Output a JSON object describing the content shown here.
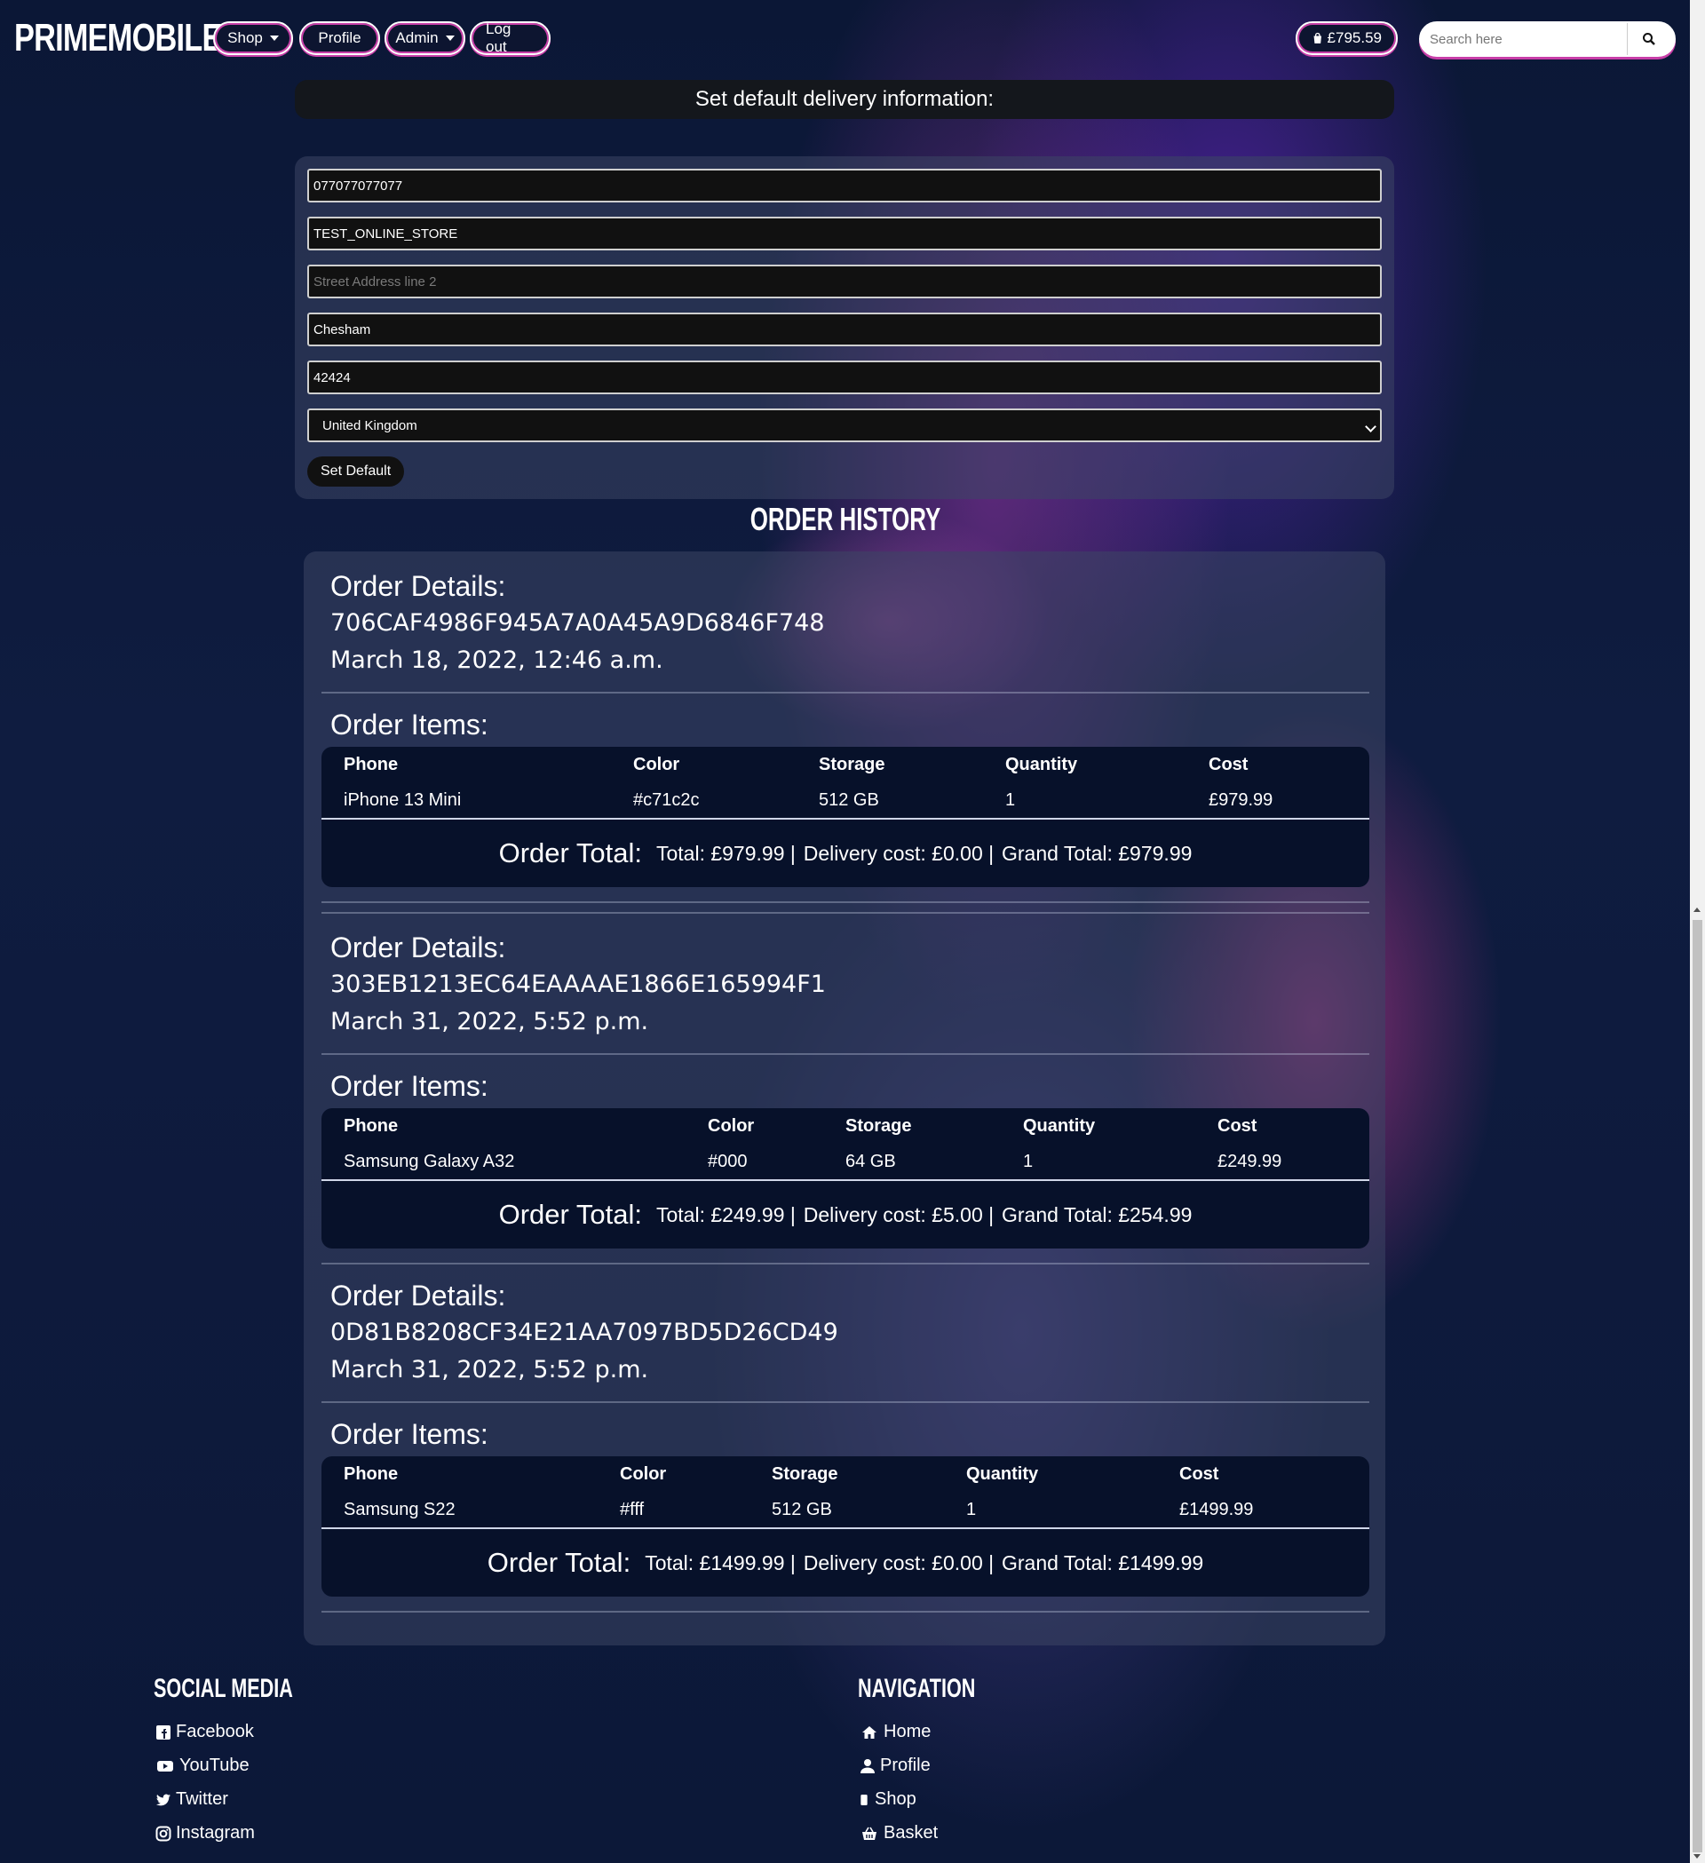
{
  "nav": {
    "brand": "PRIMEMOBILE",
    "shop": "Shop",
    "profile": "Profile",
    "admin": "Admin",
    "logout": "Log out",
    "basket_total": "£795.59",
    "search_placeholder": "Search here"
  },
  "delivery": {
    "title": "Set default delivery information:",
    "phone": "077077077077",
    "address1": "TEST_ONLINE_STORE",
    "address2_placeholder": "Street Address line 2",
    "city": "Chesham",
    "postcode": "42424",
    "country": "United Kingdom",
    "button": "Set Default"
  },
  "history": {
    "title": "ORDER HISTORY",
    "details_label": "Order Details:",
    "items_label": "Order Items:",
    "total_label": "Order Total:",
    "columns": [
      "Phone",
      "Color",
      "Storage",
      "Quantity",
      "Cost"
    ],
    "orders": [
      {
        "id": "706CAF4986F945A7A0A45A9D6846F748",
        "date": "March 18, 2022, 12:46 a.m.",
        "item": {
          "phone": "iPhone 13 Mini",
          "color": "#c71c2c",
          "storage": "512 GB",
          "quantity": "1",
          "cost": "£979.99"
        },
        "total": "Total: £979.99 |",
        "delivery": "Delivery cost: £0.00 |",
        "grand": "Grand Total: £979.99"
      },
      {
        "id": "303EB1213EC64EAAAAE1866E165994F1",
        "date": "March 31, 2022, 5:52 p.m.",
        "item": {
          "phone": "Samsung Galaxy A32",
          "color": "#000",
          "storage": "64 GB",
          "quantity": "1",
          "cost": "£249.99"
        },
        "total": "Total: £249.99 |",
        "delivery": "Delivery cost: £5.00 |",
        "grand": "Grand Total: £254.99"
      },
      {
        "id": "0D81B8208CF34E21AA7097BD5D26CD49",
        "date": "March 31, 2022, 5:52 p.m.",
        "item": {
          "phone": "Samsung S22",
          "color": "#fff",
          "storage": "512 GB",
          "quantity": "1",
          "cost": "£1499.99"
        },
        "total": "Total: £1499.99 |",
        "delivery": "Delivery cost: £0.00 |",
        "grand": "Grand Total: £1499.99"
      }
    ]
  },
  "footer": {
    "social_title": "SOCIAL MEDIA",
    "social": [
      "Facebook",
      "YouTube",
      "Twitter",
      "Instagram"
    ],
    "nav_title": "NAVIGATION",
    "nav": [
      "Home",
      "Profile",
      "Shop",
      "Basket"
    ]
  }
}
